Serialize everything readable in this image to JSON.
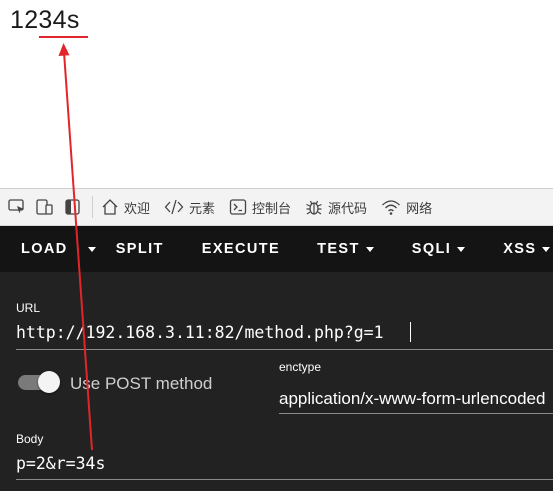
{
  "page": {
    "output_text": "1234s"
  },
  "devtools": {
    "tabs": [
      {
        "label": "欢迎"
      },
      {
        "label": "元素"
      },
      {
        "label": "控制台"
      },
      {
        "label": "源代码"
      },
      {
        "label": "网络"
      }
    ]
  },
  "hackbar": {
    "toolbar": {
      "load": "LOAD",
      "split": "SPLIT",
      "execute": "EXECUTE",
      "test": "TEST",
      "sqli": "SQLI",
      "xss": "XSS"
    },
    "url_label": "URL",
    "url_value": "http://192.168.3.11:82/method.php?g=1",
    "post_toggle_label": "Use POST method",
    "post_enabled": true,
    "enctype_label": "enctype",
    "enctype_value": "application/x-www-form-urlencoded",
    "body_label": "Body",
    "body_value": "p=2&r=34s"
  },
  "annotation": {
    "color": "#e0262b"
  }
}
